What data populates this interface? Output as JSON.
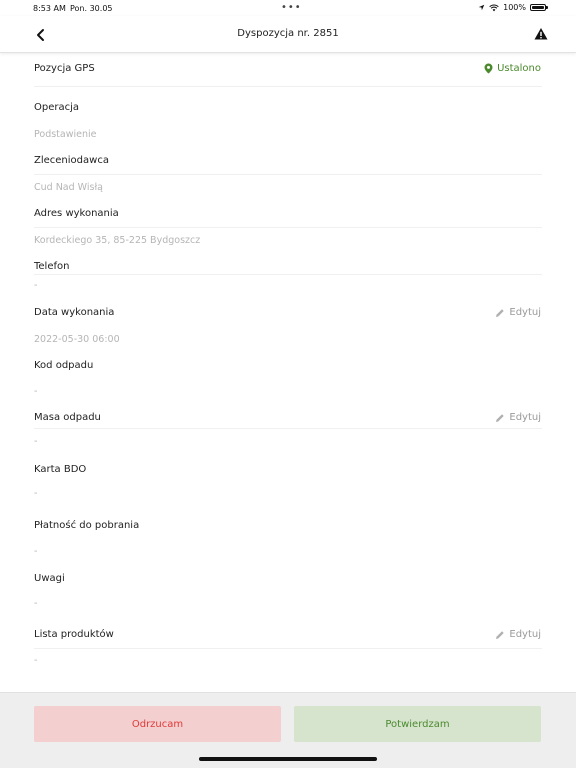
{
  "status_bar": {
    "time": "8:53 AM",
    "date": "Pon. 30.05",
    "battery": "100%"
  },
  "nav": {
    "title": "Dyspozycja nr. 2851"
  },
  "gps": {
    "label": "Pozycja GPS",
    "status": "Ustalono"
  },
  "fields": {
    "operacja": {
      "label": "Operacja",
      "value": "Podstawienie"
    },
    "zleceniodawca": {
      "label": "Zleceniodawca",
      "value": "Cud Nad Wisłą"
    },
    "adres": {
      "label": "Adres wykonania",
      "value": "Kordeckiego 35, 85-225 Bydgoszcz"
    },
    "telefon": {
      "label": "Telefon",
      "value": "-"
    },
    "data": {
      "label": "Data wykonania",
      "value": "2022-05-30 06:00",
      "edit": "Edytuj"
    },
    "kod": {
      "label": "Kod odpadu",
      "value": "-"
    },
    "masa": {
      "label": "Masa odpadu",
      "value": "-",
      "edit": "Edytuj"
    },
    "bdo": {
      "label": "Karta BDO",
      "value": "-"
    },
    "platnosc": {
      "label": "Płatność do pobrania",
      "value": "-"
    },
    "uwagi": {
      "label": "Uwagi",
      "value": "-"
    },
    "produkty": {
      "label": "Lista produktów",
      "value": "-",
      "edit": "Edytuj"
    }
  },
  "buttons": {
    "reject": "Odrzucam",
    "confirm": "Potwierdzam"
  },
  "colors": {
    "accent_green": "#4a8a2c",
    "reject_red": "#e03a3a",
    "reject_bg": "#f3cfcf",
    "confirm_bg": "#d6e4ce"
  },
  "icons": {
    "back": "chevron-left-icon",
    "warning": "warning-triangle-icon",
    "gps": "location-pin-icon",
    "edit": "pencil-icon"
  }
}
